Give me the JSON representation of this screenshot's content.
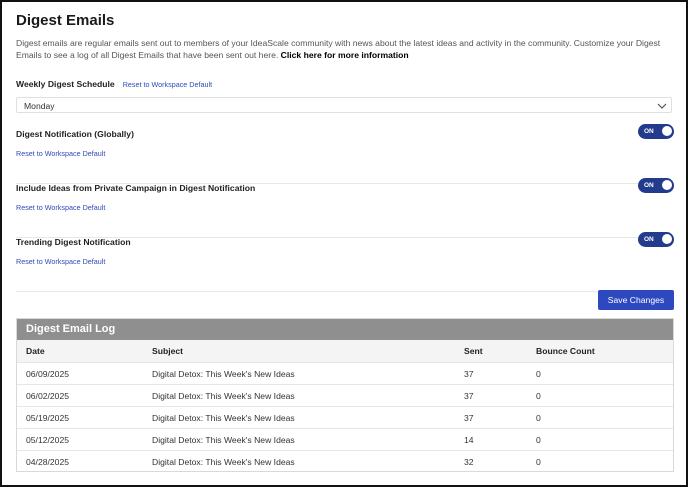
{
  "page": {
    "title": "Digest Emails",
    "description": "Digest emails are regular emails sent out to members of your IdeaScale community with news about the latest ideas and activity in the community. Customize your Digest Emails to see a log of all Digest Emails that have been sent out here.",
    "more_info_link": "Click here for more information"
  },
  "schedule": {
    "label": "Weekly Digest Schedule",
    "reset_label": "Reset to Workspace Default",
    "selected": "Monday"
  },
  "settings": [
    {
      "label": "Digest Notification (Globally)",
      "reset_label": "Reset to Workspace Default",
      "toggle_label": "ON",
      "enabled": true
    },
    {
      "label": "Include Ideas from Private Campaign in Digest Notification",
      "reset_label": "Reset to Workspace Default",
      "toggle_label": "ON",
      "enabled": true
    },
    {
      "label": "Trending Digest Notification",
      "reset_label": "Reset to Workspace Default",
      "toggle_label": "ON",
      "enabled": true
    }
  ],
  "save_button": "Save Changes",
  "log": {
    "title": "Digest Email Log",
    "columns": [
      "Date",
      "Subject",
      "Sent",
      "Bounce Count"
    ],
    "rows": [
      [
        "06/09/2025",
        "Digital Detox: This Week's New Ideas",
        "37",
        "0"
      ],
      [
        "06/02/2025",
        "Digital Detox: This Week's New Ideas",
        "37",
        "0"
      ],
      [
        "05/19/2025",
        "Digital Detox: This Week's New Ideas",
        "37",
        "0"
      ],
      [
        "05/12/2025",
        "Digital Detox: This Week's New Ideas",
        "14",
        "0"
      ],
      [
        "04/28/2025",
        "Digital Detox: This Week's New Ideas",
        "32",
        "0"
      ]
    ]
  },
  "colors": {
    "accent": "#2e49c0",
    "toggle_on": "#233b8c",
    "link": "#2f4ab8",
    "log_header": "#8f8f8f"
  },
  "icons": {
    "select_arrow": "chevron-down-icon"
  }
}
